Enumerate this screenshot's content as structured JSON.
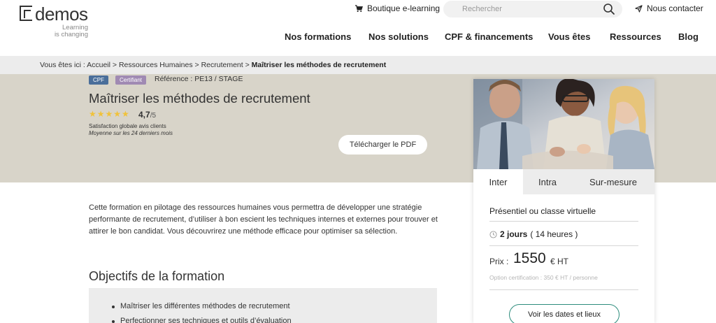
{
  "brand": {
    "name": "demos",
    "tagline_line1": "Learning",
    "tagline_line2": "is changing"
  },
  "header": {
    "shop_label": "Boutique e-learning",
    "search_placeholder": "Rechercher",
    "contact_label": "Nous contacter",
    "nav": [
      "Nos formations",
      "Nos solutions",
      "CPF & financements",
      "Vous êtes",
      "Ressources",
      "Blog"
    ]
  },
  "breadcrumb": {
    "prefix": "Vous êtes ici : ",
    "items": [
      "Accueil",
      "Ressources Humaines",
      "Recrutement"
    ],
    "separator": " > ",
    "current": "Maîtriser les méthodes de recrutement"
  },
  "hero": {
    "badges": [
      "CPF",
      "Certifiant"
    ],
    "reference": "Référence : PE13  / STAGE",
    "title": "Maîtriser les méthodes de recrutement",
    "stars": "★★★★★",
    "rating_value": "4,7",
    "rating_max": "/5",
    "rating_stars_count": 5,
    "satisfaction_line1": "Satisfaction globale avis clients",
    "satisfaction_line2": "Moyenne sur les 24 derniers mois",
    "pdf_button": "Télécharger le PDF"
  },
  "card": {
    "tabs": [
      "Inter",
      "Intra",
      "Sur-mesure"
    ],
    "active_tab": "Inter",
    "mode": "Présentiel ou classe virtuelle",
    "duration_days": "2 jours",
    "duration_hours": " ( 14 heures )",
    "price_label": "Prix :",
    "price_value": "1550",
    "price_suffix": "€ HT",
    "certification_option": "Option certification : 350 € HT / personne",
    "dates_button": "Voir les dates et lieux"
  },
  "content": {
    "description": "Cette formation en pilotage des ressources humaines vous permettra de développer une stratégie performante de recrutement, d’utiliser à bon escient les techniques internes et externes pour trouver et attirer le bon candidat. Vous découvrirez une méthode efficace pour optimiser sa sélection.",
    "objectives_title": "Objectifs de la formation",
    "objectives": [
      "Maîtriser les différentes méthodes de recrutement",
      "Perfectionner ses techniques et outils d’évaluation"
    ]
  },
  "colors": {
    "hero_bg": "#d8d4c9",
    "breadcrumb_bg": "#ececec",
    "badge_cpf": "#4a6e9a",
    "badge_cert": "#a08ab3",
    "star": "#f0c23a",
    "button_border": "#2d8c7c"
  }
}
